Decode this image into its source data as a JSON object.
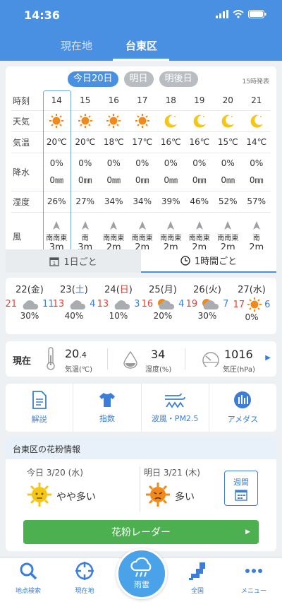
{
  "status": {
    "time": "14:36"
  },
  "location_tabs": [
    {
      "label": "現在地"
    },
    {
      "label": "台東区"
    }
  ],
  "day_tabs": [
    {
      "label": "今日20日"
    },
    {
      "label": "明日"
    },
    {
      "label": "明後日"
    }
  ],
  "issued": "15時発表",
  "hourly": {
    "labels": {
      "time": "時刻",
      "weather": "天気",
      "temp": "気温",
      "precip": "降水",
      "humidity": "湿度",
      "wind": "風"
    },
    "hours": [
      "14",
      "15",
      "16",
      "17",
      "18",
      "19",
      "20",
      "21"
    ],
    "weather": [
      "sun",
      "sun",
      "sun",
      "sun",
      "moon",
      "moon",
      "moon",
      "moon"
    ],
    "temps": [
      "20℃",
      "20℃",
      "18℃",
      "17℃",
      "16℃",
      "16℃",
      "15℃",
      "14℃"
    ],
    "precip_pct": [
      "0%",
      "0%",
      "0%",
      "0%",
      "0%",
      "0%",
      "0%",
      "0%"
    ],
    "precip_mm": [
      "0㎜",
      "0㎜",
      "0㎜",
      "0㎜",
      "0㎜",
      "0㎜",
      "0㎜",
      "0㎜"
    ],
    "humidity": [
      "26%",
      "27%",
      "34%",
      "34%",
      "39%",
      "46%",
      "52%",
      "57%"
    ],
    "wind_dir": [
      "南南東",
      "南",
      "南南東",
      "南南東",
      "南南東",
      "南南東",
      "南南東",
      "南"
    ],
    "wind_speed": [
      "3m",
      "3m",
      "2m",
      "2m",
      "2m",
      "2m",
      "2m",
      "2m"
    ]
  },
  "view_switch": {
    "daily": "1日ごと",
    "hourly": "1時間ごと"
  },
  "weekly": [
    {
      "date": "22",
      "dow": "金",
      "dow_color": "#333333",
      "icon": "cloud",
      "hi": "21",
      "lo": "11",
      "pop": "30%"
    },
    {
      "date": "23",
      "dow": "土",
      "dow_color": "#3b7dd8",
      "icon": "cloud",
      "hi": "13",
      "lo": "4",
      "pop": "40%"
    },
    {
      "date": "24",
      "dow": "日",
      "dow_color": "#e0443a",
      "icon": "cloud",
      "hi": "13",
      "lo": "3",
      "pop": "10%"
    },
    {
      "date": "25",
      "dow": "月",
      "dow_color": "#333333",
      "icon": "sun-cloud",
      "hi": "16",
      "lo": "4",
      "pop": "20%"
    },
    {
      "date": "26",
      "dow": "火",
      "dow_color": "#333333",
      "icon": "sun-cloud",
      "hi": "19",
      "lo": "7",
      "pop": "30%"
    },
    {
      "date": "27",
      "dow": "水",
      "dow_color": "#333333",
      "icon": "sun",
      "hi": "17",
      "lo": "6",
      "pop": "0%"
    }
  ],
  "current": {
    "label": "現在",
    "temp_int": "20",
    "temp_dec": ".4",
    "temp_unit": "気温(℃)",
    "humidity": "34",
    "humidity_unit": "湿度(%)",
    "pressure": "1016",
    "pressure_unit": "気圧(hPa)"
  },
  "tools": [
    {
      "label": "解説"
    },
    {
      "label": "指数"
    },
    {
      "label": "波風・PM2.5"
    },
    {
      "label": "アメダス"
    }
  ],
  "pollen": {
    "header": "台東区の花粉情報",
    "today": {
      "date": "今日 3/20 (水)",
      "level": "やや多い"
    },
    "tomorrow": {
      "date": "明日 3/21 (木)",
      "level": "多い"
    },
    "weekly_button": "週間",
    "radar_button": "花粉レーダー"
  },
  "nav": [
    {
      "label": "地点検索"
    },
    {
      "label": "現在地"
    },
    {
      "label": "雨雲"
    },
    {
      "label": "全国"
    },
    {
      "label": "メニュー"
    }
  ],
  "colors": {
    "primary": "#4a90e2",
    "high": "#e0443a",
    "low": "#3b7dd8",
    "green": "#4caf50"
  }
}
